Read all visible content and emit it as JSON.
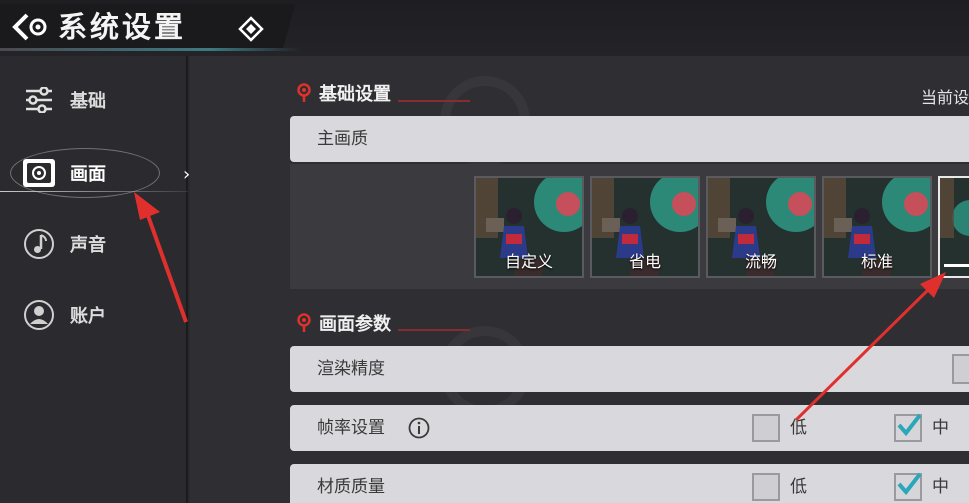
{
  "header": {
    "title": "系统设置"
  },
  "sidebar": {
    "items": [
      {
        "label": "基础",
        "icon": "sliders-icon"
      },
      {
        "label": "画面",
        "icon": "display-icon"
      },
      {
        "label": "声音",
        "icon": "music-note-icon"
      },
      {
        "label": "账户",
        "icon": "user-icon"
      }
    ],
    "active_index": 1
  },
  "main": {
    "basic_section": {
      "title": "基础设置",
      "current_label": "当前设"
    },
    "main_quality": {
      "label": "主画质",
      "presets": [
        "自定义",
        "省电",
        "流畅",
        "标准",
        ""
      ]
    },
    "graphics_section": {
      "title": "画面参数"
    },
    "render_precision": {
      "label": "渲染精度"
    },
    "frame_rate": {
      "label": "帧率设置",
      "options": [
        {
          "label": "低",
          "checked": false
        },
        {
          "label": "中",
          "checked": true
        }
      ]
    },
    "texture_quality": {
      "label": "材质质量",
      "options": [
        {
          "label": "低",
          "checked": false
        },
        {
          "label": "中",
          "checked": true
        }
      ]
    }
  },
  "colors": {
    "accent_red": "#e0302e",
    "check_teal": "#2aa7b8",
    "row_bg": "#d9d9dd"
  }
}
